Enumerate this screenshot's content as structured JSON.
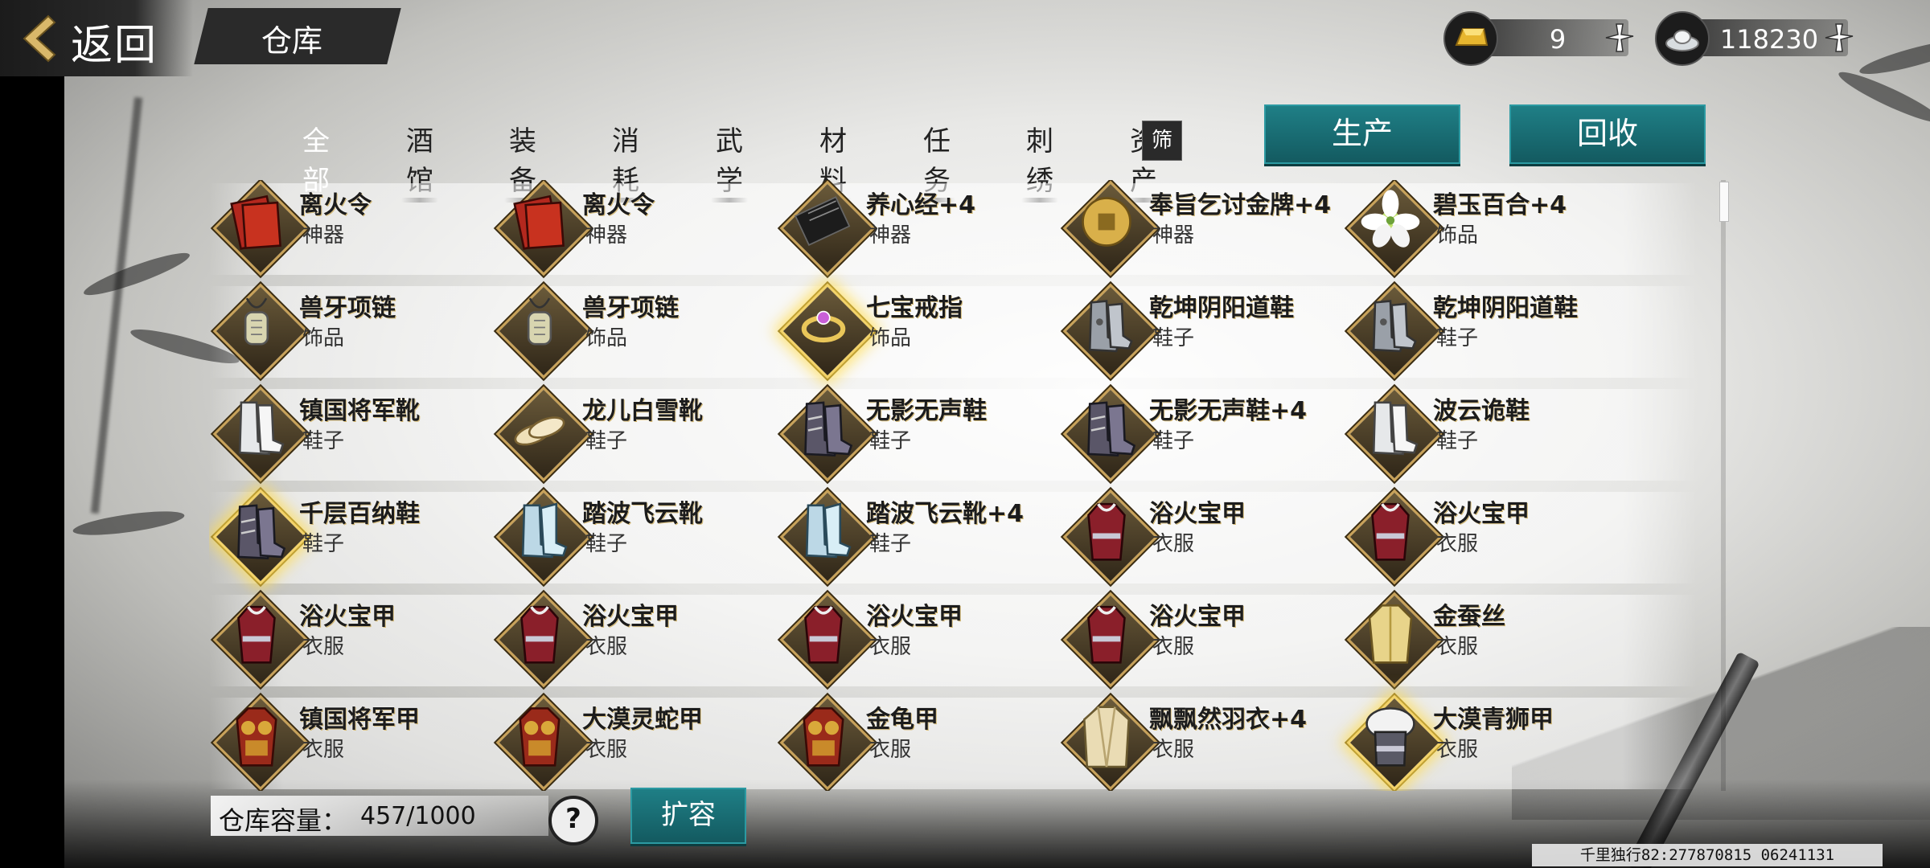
{
  "header": {
    "back_label": "返回",
    "title": "仓库"
  },
  "currency": {
    "gold": {
      "icon": "gold-ingot-icon",
      "value": "9"
    },
    "silver": {
      "icon": "silver-ingot-icon",
      "value": "118230"
    }
  },
  "tabs": [
    "全部",
    "酒馆",
    "装备",
    "消耗",
    "武学",
    "材料",
    "任务",
    "刺绣",
    "资产"
  ],
  "active_tab": "全部",
  "filter_label": "筛",
  "buttons": {
    "produce": "生产",
    "recycle": "回收",
    "expand": "扩容",
    "help": "?"
  },
  "items": [
    {
      "name": "离火令",
      "type": "神器",
      "icon": "red-book-icon"
    },
    {
      "name": "离火令",
      "type": "神器",
      "icon": "red-book-icon"
    },
    {
      "name": "养心经+4",
      "type": "神器",
      "icon": "black-scroll-icon"
    },
    {
      "name": "奉旨乞讨金牌+4",
      "type": "神器",
      "icon": "gold-medal-icon"
    },
    {
      "name": "碧玉百合+4",
      "type": "饰品",
      "icon": "lily-flower-icon"
    },
    {
      "name": "兽牙项链",
      "type": "饰品",
      "icon": "necklace-icon"
    },
    {
      "name": "兽牙项链",
      "type": "饰品",
      "icon": "necklace-icon"
    },
    {
      "name": "七宝戒指",
      "type": "饰品",
      "icon": "ring-icon",
      "highlight": true
    },
    {
      "name": "乾坤阴阳道鞋",
      "type": "鞋子",
      "icon": "armored-boots-icon"
    },
    {
      "name": "乾坤阴阳道鞋",
      "type": "鞋子",
      "icon": "armored-boots-icon"
    },
    {
      "name": "镇国将军靴",
      "type": "鞋子",
      "icon": "white-boots-icon"
    },
    {
      "name": "龙儿白雪靴",
      "type": "鞋子",
      "icon": "slippers-icon"
    },
    {
      "name": "无影无声鞋",
      "type": "鞋子",
      "icon": "dark-boots-icon"
    },
    {
      "name": "无影无声鞋+4",
      "type": "鞋子",
      "icon": "dark-boots-icon"
    },
    {
      "name": "波云诡鞋",
      "type": "鞋子",
      "icon": "white-boots-icon"
    },
    {
      "name": "千层百纳鞋",
      "type": "鞋子",
      "icon": "dark-boots-icon",
      "highlight": true
    },
    {
      "name": "踏波飞云靴",
      "type": "鞋子",
      "icon": "blue-boots-icon"
    },
    {
      "name": "踏波飞云靴+4",
      "type": "鞋子",
      "icon": "blue-boots-icon"
    },
    {
      "name": "浴火宝甲",
      "type": "衣服",
      "icon": "red-robe-icon"
    },
    {
      "name": "浴火宝甲",
      "type": "衣服",
      "icon": "red-robe-icon"
    },
    {
      "name": "浴火宝甲",
      "type": "衣服",
      "icon": "red-robe-icon"
    },
    {
      "name": "浴火宝甲",
      "type": "衣服",
      "icon": "red-robe-icon"
    },
    {
      "name": "浴火宝甲",
      "type": "衣服",
      "icon": "red-robe-icon"
    },
    {
      "name": "浴火宝甲",
      "type": "衣服",
      "icon": "red-robe-icon"
    },
    {
      "name": "金蚕丝",
      "type": "衣服",
      "icon": "yellow-robe-icon"
    },
    {
      "name": "镇国将军甲",
      "type": "衣服",
      "icon": "gold-armor-icon"
    },
    {
      "name": "大漠灵蛇甲",
      "type": "衣服",
      "icon": "gold-armor-icon"
    },
    {
      "name": "金龟甲",
      "type": "衣服",
      "icon": "gold-armor-icon"
    },
    {
      "name": "飘飘然羽衣+4",
      "type": "衣服",
      "icon": "cream-robe-icon"
    },
    {
      "name": "大漠青狮甲",
      "type": "衣服",
      "icon": "fur-armor-icon",
      "highlight": true
    }
  ],
  "capacity": {
    "label": "仓库容量：",
    "value": "457/1000"
  },
  "watermark": "千里独行82:277870815 06241131",
  "colors": {
    "teal": "#1f7f86",
    "gold_frame": "#c8a25a",
    "robe_red": "#8a1f2a"
  }
}
